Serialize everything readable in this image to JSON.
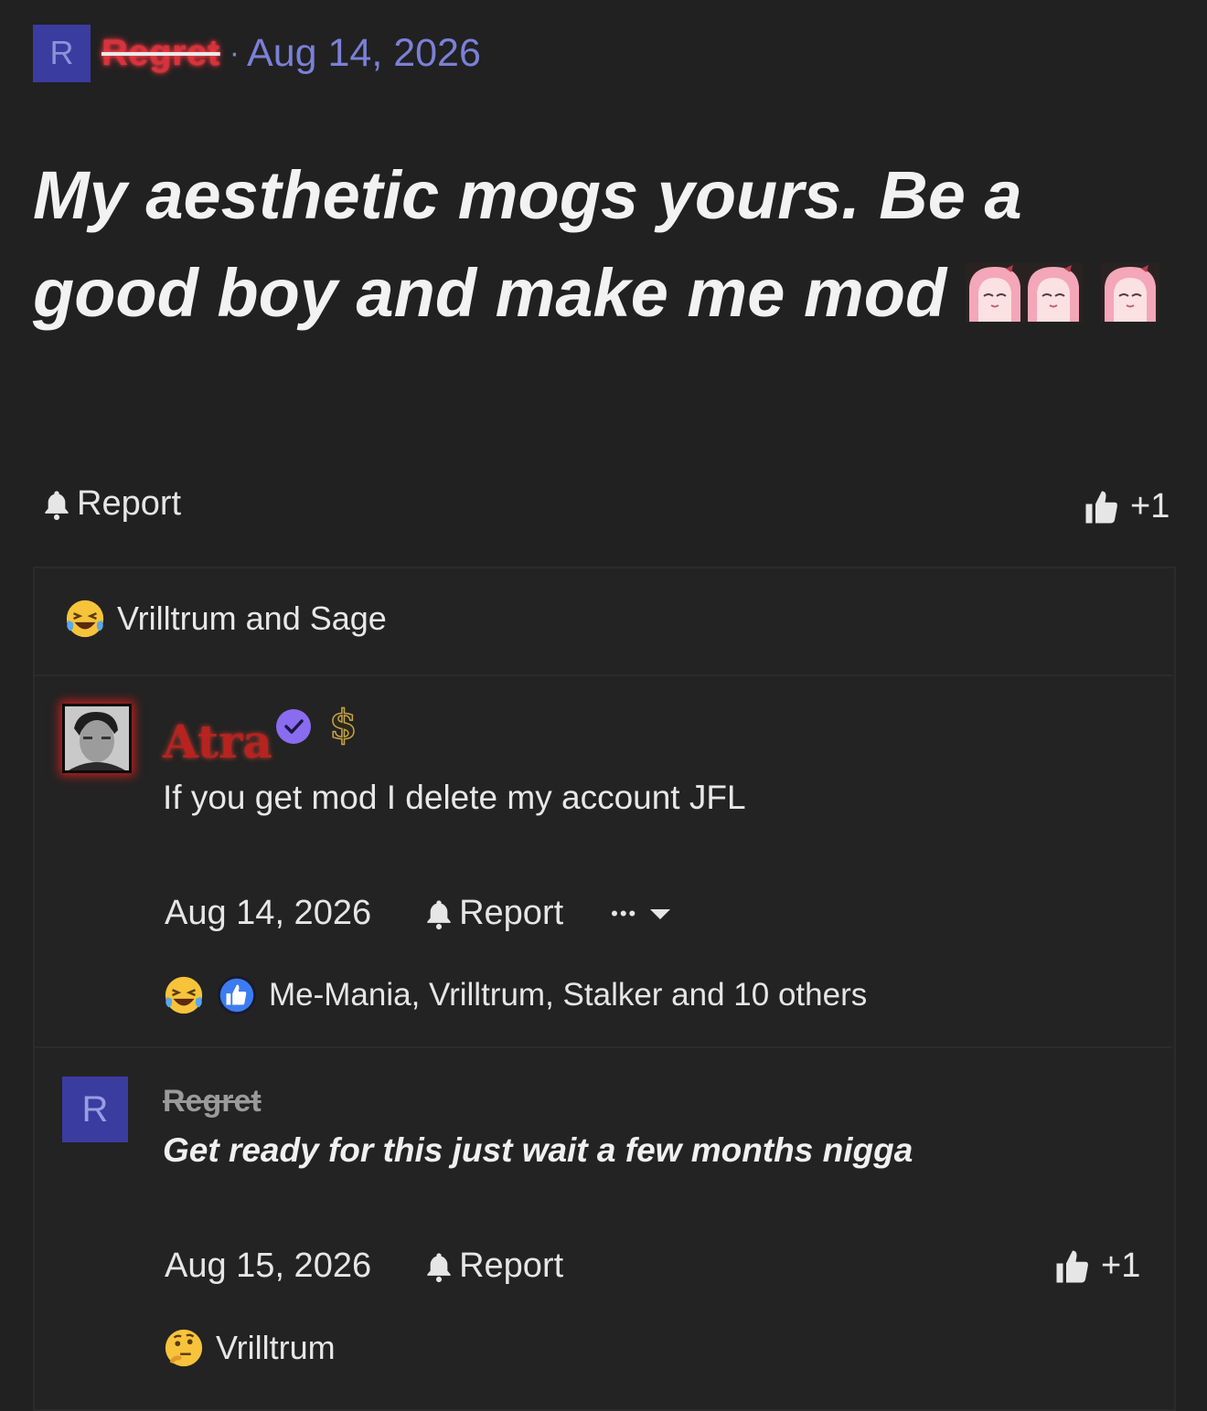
{
  "post": {
    "avatar_letter": "R",
    "author": "Regret",
    "separator": "·",
    "date": "Aug 14, 2026",
    "title": "My aesthetic mogs yours. Be a good boy and make me mod",
    "report_label": "Report",
    "like_count": "+1",
    "reactors": "Vrilltrum and Sage"
  },
  "comments": [
    {
      "author": "Atra",
      "badge": "$",
      "text": "If you get mod I delete my account JFL",
      "date": "Aug 14, 2026",
      "report_label": "Report",
      "more_label": "•••",
      "reactors": "Me-Mania, Vrilltrum, Stalker and 10 others"
    },
    {
      "avatar_letter": "R",
      "author": "Regret",
      "text": "Get ready for this just wait a few months nigga",
      "date": "Aug 15, 2026",
      "report_label": "Report",
      "like_count": "+1",
      "reactors": "Vrilltrum"
    }
  ],
  "colors": {
    "background": "#212121",
    "accent": "#7b80d8",
    "avatar_bg": "#3b3ca0",
    "username_red": "#d8323a",
    "verified": "#8a6cf0"
  }
}
